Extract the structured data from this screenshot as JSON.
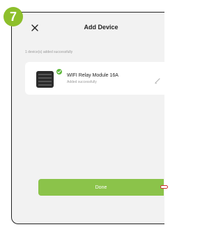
{
  "step_badge": "7",
  "header": {
    "title": "Add Device",
    "close_icon": "close-icon"
  },
  "status": {
    "message": "1 device(s) added successfully"
  },
  "device": {
    "name": "WIFI Relay Module 16A",
    "status": "Added successfully",
    "check_icon": "check-icon",
    "edit_icon": "pencil-icon"
  },
  "actions": {
    "done_label": "Done"
  },
  "colors": {
    "step_badge": "#8dbf2c",
    "done_button": "#8bc34a",
    "check_badge": "#5db83a",
    "pointer_marker": "#d12b2b",
    "background": "#f2f2f2"
  }
}
